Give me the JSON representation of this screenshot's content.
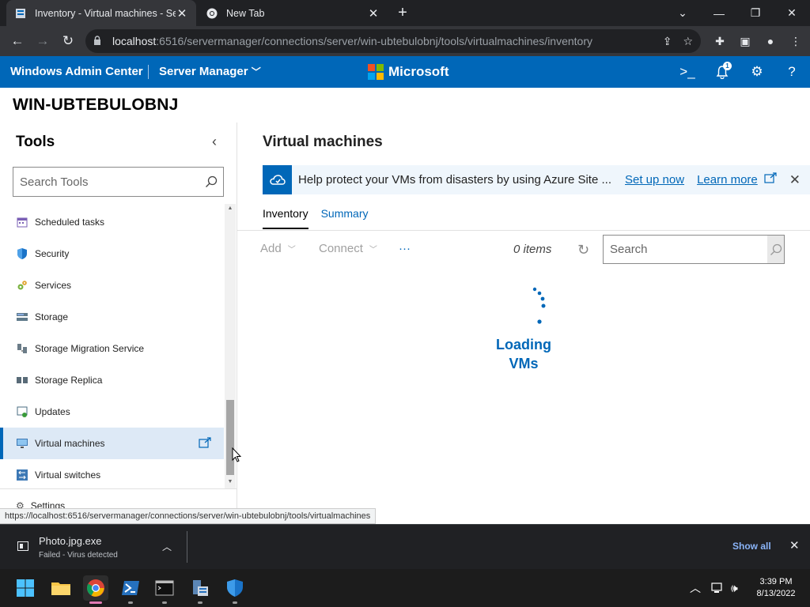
{
  "browser": {
    "tabs": [
      {
        "title": "Inventory - Virtual machines - Se",
        "active": true
      },
      {
        "title": "New Tab",
        "active": false
      }
    ],
    "url_host": "localhost",
    "url_path": ":6516/servermanager/connections/server/win-ubtebulobnj/tools/virtualmachines/inventory",
    "status_url": "https://localhost:6516/servermanager/connections/server/win-ubtebulobnj/tools/virtualmachines"
  },
  "header": {
    "app_name": "Windows Admin Center",
    "context": "Server Manager",
    "brand": "Microsoft",
    "notification_count": "1"
  },
  "server_name": "WIN-UBTEBULOBNJ",
  "tools": {
    "title": "Tools",
    "search_placeholder": "Search Tools",
    "items": [
      {
        "label": "Scheduled tasks",
        "icon": "calendar-icon"
      },
      {
        "label": "Security",
        "icon": "shield-icon"
      },
      {
        "label": "Services",
        "icon": "gears-icon"
      },
      {
        "label": "Storage",
        "icon": "storage-icon"
      },
      {
        "label": "Storage Migration Service",
        "icon": "migration-icon"
      },
      {
        "label": "Storage Replica",
        "icon": "replica-icon"
      },
      {
        "label": "Updates",
        "icon": "updates-icon"
      },
      {
        "label": "Virtual machines",
        "icon": "vm-icon",
        "selected": true
      },
      {
        "label": "Virtual switches",
        "icon": "switch-icon"
      }
    ],
    "settings_label": "Settings"
  },
  "main": {
    "title": "Virtual machines",
    "banner": {
      "text": "Help protect your VMs from disasters by using Azure Site ...",
      "setup_link": "Set up now",
      "learn_link": "Learn more"
    },
    "tabs": [
      "Inventory",
      "Summary"
    ],
    "toolbar": {
      "add": "Add",
      "connect": "Connect",
      "more": "···",
      "items_count": "0 items",
      "search_placeholder": "Search"
    },
    "loading_line1": "Loading",
    "loading_line2": "VMs"
  },
  "download": {
    "file_name": "Photo.jpg.exe",
    "status": "Failed - Virus detected",
    "show_all": "Show all"
  },
  "taskbar": {
    "time": "3:39 PM",
    "date": "8/13/2022"
  },
  "colors": {
    "accent": "#0067b8",
    "selected_bg": "#dde9f6"
  }
}
